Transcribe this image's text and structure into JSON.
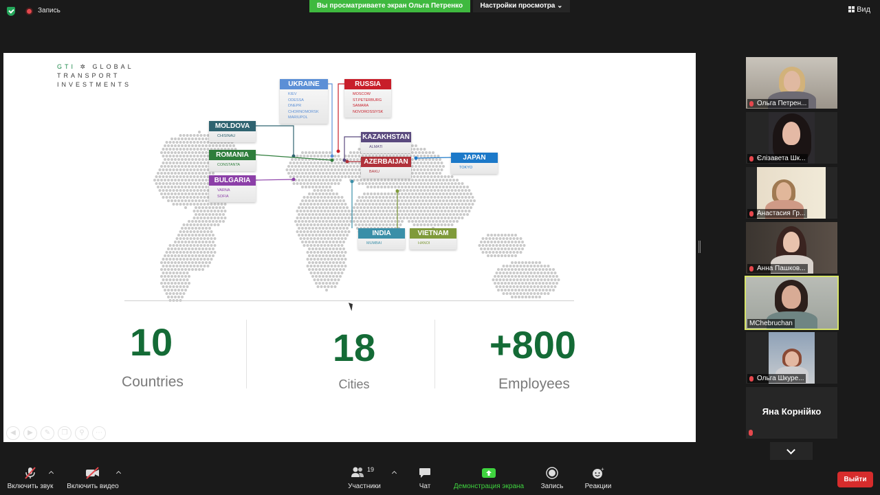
{
  "topbar": {
    "recording_label": "Запись",
    "share_banner": "Вы просматриваете экран Ольга Петренко",
    "view_settings": "Настройки просмотра ⌄",
    "view_button": "Вид"
  },
  "slide": {
    "logo_line1_a": "GTI",
    "logo_line1_b": "✲ GLOBAL",
    "logo_line2": "TRANSPORT",
    "logo_line3": "INVESTMENTS",
    "countries": [
      {
        "name": "UKRAINE",
        "color": "#5b8fd6",
        "cities": [
          "KIEV",
          "ODESSA",
          "DNEPR",
          "CHORNOMORSK",
          "MARIUPOL"
        ]
      },
      {
        "name": "RUSSIA",
        "color": "#c81e2a",
        "cities": [
          "MOSCOW",
          "ST.PETERBURG",
          "SAMARA",
          "NOVOROSSIYSK"
        ]
      },
      {
        "name": "MOLDOVA",
        "color": "#2f6370",
        "cities": [
          "CHISINAU"
        ]
      },
      {
        "name": "KAZAKHSTAN",
        "color": "#5a4a7e",
        "cities": [
          "ALMATI"
        ]
      },
      {
        "name": "ROMANIA",
        "color": "#2e7d3b",
        "cities": [
          "CONSTANTA"
        ]
      },
      {
        "name": "AZERBAIJAN",
        "color": "#b0323a",
        "cities": [
          "BAKU"
        ]
      },
      {
        "name": "JAPAN",
        "color": "#1c79c9",
        "cities": [
          "TOKYO"
        ]
      },
      {
        "name": "BULGARIA",
        "color": "#8c3fa8",
        "cities": [
          "VARNA",
          "SOFIA"
        ]
      },
      {
        "name": "INDIA",
        "color": "#3a8fa8",
        "cities": [
          "MUMBAI"
        ]
      },
      {
        "name": "VIETNAM",
        "color": "#7f9a3a",
        "cities": [
          "HANOI"
        ]
      }
    ],
    "stats": [
      {
        "value": "10",
        "label": "Countries"
      },
      {
        "value": "18",
        "label": "Cities"
      },
      {
        "value": "+800",
        "label": "Employees"
      }
    ]
  },
  "participants": [
    {
      "name": "Ольга Петрен..."
    },
    {
      "name": "Єлізавета Шк..."
    },
    {
      "name": "Анастасия Гр..."
    },
    {
      "name": "Анна Пашков..."
    },
    {
      "name": "MChebruchan"
    },
    {
      "name": "Ольга Шкуре..."
    },
    {
      "name": "Яна Корнійко"
    }
  ],
  "toolbar": {
    "mute_label": "Включить звук",
    "video_label": "Включить видео",
    "participants_label": "Участники",
    "participants_count": "19",
    "chat_label": "Чат",
    "share_label": "Демонстрация экрана",
    "record_label": "Запись",
    "reactions_label": "Реакции",
    "exit_label": "Выйти"
  },
  "colors": {
    "accent_green": "#3fb93f",
    "stat_green": "#146b36",
    "exit_red": "#d62c2c"
  }
}
